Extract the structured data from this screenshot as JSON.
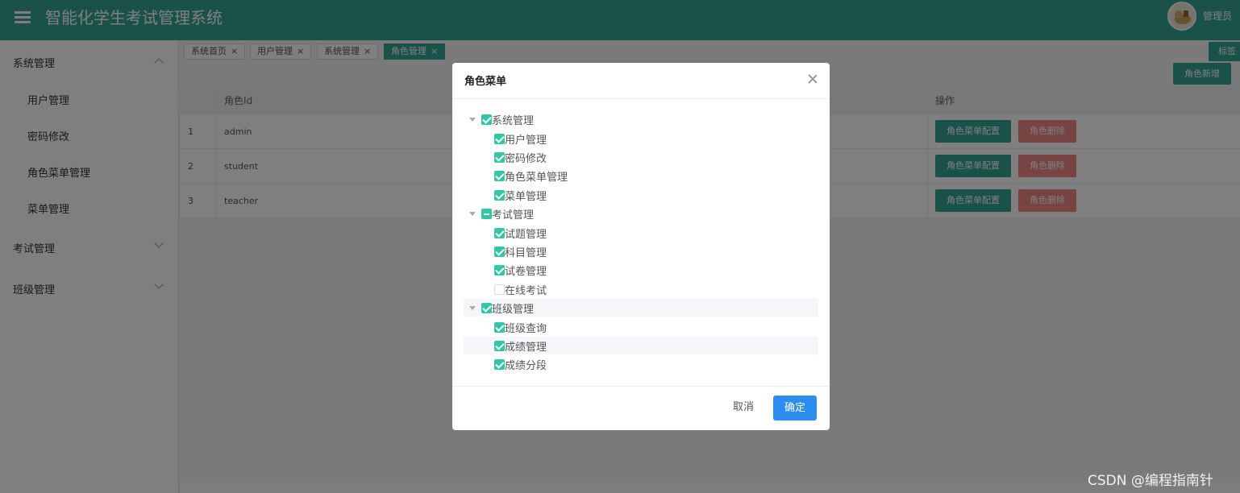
{
  "header": {
    "app_title": "智能化学生考试管理系统",
    "user_name": "管理员"
  },
  "sidebar": {
    "groups": [
      {
        "label": "系统管理",
        "expanded": true,
        "items": [
          "用户管理",
          "密码修改",
          "角色菜单管理",
          "菜单管理"
        ]
      },
      {
        "label": "考试管理",
        "expanded": false
      },
      {
        "label": "班级管理",
        "expanded": false
      }
    ]
  },
  "tags": {
    "items": [
      {
        "label": "系统首页",
        "close": "×"
      },
      {
        "label": "用户管理",
        "close": "×"
      },
      {
        "label": "系统管理",
        "close": "×"
      },
      {
        "label": "角色管理",
        "close": "×",
        "active": true
      }
    ],
    "right_label": "标签"
  },
  "toolbar": {
    "add_role_label": "角色新增"
  },
  "table": {
    "headers": [
      "",
      "角色Id",
      "操作"
    ],
    "rows": [
      {
        "index": "1",
        "role_id": "admin"
      },
      {
        "index": "2",
        "role_id": "student"
      },
      {
        "index": "3",
        "role_id": "teacher"
      }
    ],
    "config_label": "角色菜单配置",
    "delete_label": "角色删除"
  },
  "dialog": {
    "title": "角色菜单",
    "tree": [
      {
        "label": "系统管理",
        "state": "checked",
        "children": [
          {
            "label": "用户管理",
            "state": "checked"
          },
          {
            "label": "密码修改",
            "state": "checked"
          },
          {
            "label": "角色菜单管理",
            "state": "checked"
          },
          {
            "label": "菜单管理",
            "state": "checked"
          }
        ]
      },
      {
        "label": "考试管理",
        "state": "partial",
        "children": [
          {
            "label": "试题管理",
            "state": "checked"
          },
          {
            "label": "科目管理",
            "state": "checked"
          },
          {
            "label": "试卷管理",
            "state": "checked"
          },
          {
            "label": "在线考试",
            "state": "unchecked"
          }
        ]
      },
      {
        "label": "班级管理",
        "state": "checked",
        "children": [
          {
            "label": "班级查询",
            "state": "checked"
          },
          {
            "label": "成绩管理",
            "state": "checked"
          },
          {
            "label": "成绩分段",
            "state": "checked"
          }
        ]
      }
    ],
    "cancel_label": "取消",
    "confirm_label": "确定"
  },
  "watermark": "CSDN @编程指南针",
  "colors": {
    "primary": "#34a492",
    "danger": "#ef8686",
    "confirm": "#2d8cf0",
    "checkbox": "#34c6a6"
  }
}
